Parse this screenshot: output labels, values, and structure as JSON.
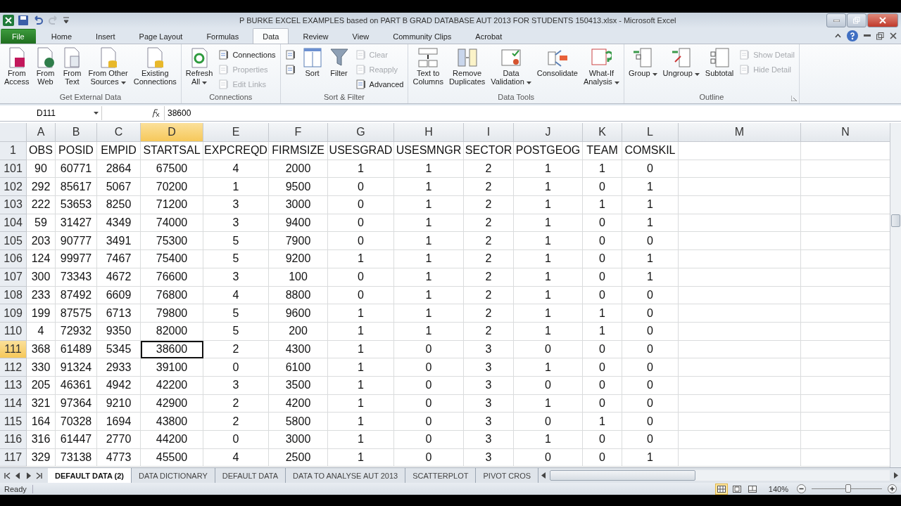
{
  "window": {
    "title": "P BURKE EXCEL EXAMPLES based on PART B GRAD DATABASE AUT 2013 FOR STUDENTS 150413.xlsx  -  Microsoft Excel"
  },
  "tabs": [
    {
      "label": "File",
      "kind": "file",
      "selected": false
    },
    {
      "label": "Home",
      "kind": "tab",
      "selected": false
    },
    {
      "label": "Insert",
      "kind": "tab",
      "selected": false
    },
    {
      "label": "Page Layout",
      "kind": "tab",
      "selected": false
    },
    {
      "label": "Formulas",
      "kind": "tab",
      "selected": false
    },
    {
      "label": "Data",
      "kind": "tab",
      "selected": true
    },
    {
      "label": "Review",
      "kind": "tab",
      "selected": false
    },
    {
      "label": "View",
      "kind": "tab",
      "selected": false
    },
    {
      "label": "Community Clips",
      "kind": "tab",
      "selected": false
    },
    {
      "label": "Acrobat",
      "kind": "tab",
      "selected": false
    }
  ],
  "ribbon": {
    "groups": [
      {
        "label": "Get External Data",
        "items": [
          {
            "kind": "large",
            "lines": [
              "From",
              "Access"
            ]
          },
          {
            "kind": "large",
            "lines": [
              "From",
              "Web"
            ]
          },
          {
            "kind": "large",
            "lines": [
              "From",
              "Text"
            ]
          },
          {
            "kind": "large",
            "lines": [
              "From Other",
              "Sources"
            ],
            "dropdown": true
          },
          {
            "kind": "large",
            "lines": [
              "Existing",
              "Connections"
            ]
          }
        ]
      },
      {
        "label": "Connections",
        "items": [
          {
            "kind": "large",
            "lines": [
              "Refresh",
              "All"
            ],
            "dropdown": true
          },
          {
            "kind": "stack",
            "items": [
              {
                "label": "Connections",
                "disabled": false
              },
              {
                "label": "Properties",
                "disabled": true
              },
              {
                "label": "Edit Links",
                "disabled": true
              }
            ]
          }
        ]
      },
      {
        "label": "Sort & Filter",
        "items": [
          {
            "kind": "stack",
            "items": [
              {
                "disabled": false
              },
              {
                "disabled": false
              }
            ]
          },
          {
            "kind": "large",
            "lines": [
              "Sort"
            ]
          },
          {
            "kind": "large",
            "lines": [
              "Filter"
            ]
          },
          {
            "kind": "stack",
            "items": [
              {
                "label": "Clear",
                "disabled": true
              },
              {
                "label": "Reapply",
                "disabled": true
              },
              {
                "label": "Advanced",
                "disabled": false
              }
            ]
          }
        ]
      },
      {
        "label": "Data Tools",
        "items": [
          {
            "kind": "large",
            "lines": [
              "Text to",
              "Columns"
            ]
          },
          {
            "kind": "large",
            "lines": [
              "Remove",
              "Duplicates"
            ]
          },
          {
            "kind": "large",
            "lines": [
              "Data",
              "Validation"
            ],
            "dropdown": true
          },
          {
            "kind": "large",
            "lines": [
              "Consolidate"
            ]
          },
          {
            "kind": "large",
            "lines": [
              "What-If",
              "Analysis"
            ],
            "dropdown": true
          }
        ]
      },
      {
        "label": "Outline",
        "launcher": true,
        "items": [
          {
            "kind": "large",
            "lines": [
              "Group"
            ],
            "dropdown": true
          },
          {
            "kind": "large",
            "lines": [
              "Ungroup"
            ],
            "dropdown": true
          },
          {
            "kind": "large",
            "lines": [
              "Subtotal"
            ]
          },
          {
            "kind": "stack",
            "items": [
              {
                "label": "Show Detail",
                "disabled": true
              },
              {
                "label": "Hide Detail",
                "disabled": true
              }
            ]
          }
        ]
      }
    ]
  },
  "formula_bar": {
    "name_box": "D111",
    "value": "38600"
  },
  "sheet": {
    "columns": [
      {
        "label": "A",
        "selected": false
      },
      {
        "label": "B",
        "selected": false
      },
      {
        "label": "C",
        "selected": false
      },
      {
        "label": "D",
        "selected": true
      },
      {
        "label": "E",
        "selected": false
      },
      {
        "label": "F",
        "selected": false
      },
      {
        "label": "G",
        "selected": false
      },
      {
        "label": "H",
        "selected": false
      },
      {
        "label": "I",
        "selected": false
      },
      {
        "label": "J",
        "selected": false
      },
      {
        "label": "K",
        "selected": false
      },
      {
        "label": "L",
        "selected": false
      },
      {
        "label": "M",
        "selected": false
      },
      {
        "label": "N",
        "selected": false
      }
    ],
    "rows": [
      {
        "header": "1",
        "selected": false,
        "cells": [
          "OBS",
          "POSID",
          "EMPID",
          "STARTSAL",
          "EXPCREQD",
          "FIRMSIZE",
          "USESGRAD",
          "USESMNGR",
          "SECTOR",
          "POSTGEOG",
          "TEAM",
          "COMSKIL"
        ]
      },
      {
        "header": "101",
        "selected": false,
        "cells": [
          "90",
          "60771",
          "2864",
          "67500",
          "4",
          "2000",
          "1",
          "1",
          "2",
          "1",
          "1",
          "0"
        ]
      },
      {
        "header": "102",
        "selected": false,
        "cells": [
          "292",
          "85617",
          "5067",
          "70200",
          "1",
          "9500",
          "0",
          "1",
          "2",
          "1",
          "0",
          "1"
        ]
      },
      {
        "header": "103",
        "selected": false,
        "cells": [
          "222",
          "53653",
          "8250",
          "71200",
          "3",
          "3000",
          "0",
          "1",
          "2",
          "1",
          "1",
          "1"
        ]
      },
      {
        "header": "104",
        "selected": false,
        "cells": [
          "59",
          "31427",
          "4349",
          "74000",
          "3",
          "9400",
          "0",
          "1",
          "2",
          "1",
          "0",
          "1"
        ]
      },
      {
        "header": "105",
        "selected": false,
        "cells": [
          "203",
          "90777",
          "3491",
          "75300",
          "5",
          "7900",
          "0",
          "1",
          "2",
          "1",
          "0",
          "0"
        ]
      },
      {
        "header": "106",
        "selected": false,
        "cells": [
          "124",
          "99977",
          "7467",
          "75400",
          "5",
          "9200",
          "1",
          "1",
          "2",
          "1",
          "0",
          "1"
        ]
      },
      {
        "header": "107",
        "selected": false,
        "cells": [
          "300",
          "73343",
          "4672",
          "76600",
          "3",
          "100",
          "0",
          "1",
          "2",
          "1",
          "0",
          "1"
        ]
      },
      {
        "header": "108",
        "selected": false,
        "cells": [
          "233",
          "87492",
          "6609",
          "76800",
          "4",
          "8800",
          "0",
          "1",
          "2",
          "1",
          "0",
          "0"
        ]
      },
      {
        "header": "109",
        "selected": false,
        "cells": [
          "199",
          "87575",
          "6713",
          "79800",
          "5",
          "9600",
          "1",
          "1",
          "2",
          "1",
          "1",
          "0"
        ]
      },
      {
        "header": "110",
        "selected": false,
        "cells": [
          "4",
          "72932",
          "9350",
          "82000",
          "5",
          "200",
          "1",
          "1",
          "2",
          "1",
          "1",
          "0"
        ]
      },
      {
        "header": "111",
        "selected": true,
        "cells": [
          "368",
          "61489",
          "5345",
          "38600",
          "2",
          "4300",
          "1",
          "0",
          "3",
          "0",
          "0",
          "0"
        ]
      },
      {
        "header": "112",
        "selected": false,
        "cells": [
          "330",
          "91324",
          "2933",
          "39100",
          "0",
          "6100",
          "1",
          "0",
          "3",
          "1",
          "0",
          "0"
        ]
      },
      {
        "header": "113",
        "selected": false,
        "cells": [
          "205",
          "46361",
          "4942",
          "42200",
          "3",
          "3500",
          "1",
          "0",
          "3",
          "0",
          "0",
          "0"
        ]
      },
      {
        "header": "114",
        "selected": false,
        "cells": [
          "321",
          "97364",
          "9210",
          "42900",
          "2",
          "4200",
          "1",
          "0",
          "3",
          "1",
          "0",
          "0"
        ]
      },
      {
        "header": "115",
        "selected": false,
        "cells": [
          "164",
          "70328",
          "1694",
          "43800",
          "2",
          "5800",
          "1",
          "0",
          "3",
          "0",
          "1",
          "0"
        ]
      },
      {
        "header": "116",
        "selected": false,
        "cells": [
          "316",
          "61447",
          "2770",
          "44200",
          "0",
          "3000",
          "1",
          "0",
          "3",
          "1",
          "0",
          "0"
        ]
      },
      {
        "header": "117",
        "selected": false,
        "cells": [
          "329",
          "73138",
          "4773",
          "45500",
          "4",
          "2500",
          "1",
          "0",
          "3",
          "0",
          "0",
          "1"
        ]
      }
    ]
  },
  "sheet_tabs": [
    {
      "label": "DEFAULT DATA (2)",
      "selected": true
    },
    {
      "label": "DATA DICTIONARY",
      "selected": false
    },
    {
      "label": "DEFAULT DATA",
      "selected": false
    },
    {
      "label": "DATA TO ANALYSE AUT 2013",
      "selected": false
    },
    {
      "label": "SCATTERPLOT",
      "selected": false
    },
    {
      "label": "PIVOT CROS",
      "selected": false
    }
  ],
  "status_bar": {
    "status": "Ready",
    "views": [
      {
        "selected": true
      },
      {
        "selected": false
      },
      {
        "selected": false
      }
    ],
    "zoom": "140%",
    "zoom_slider": {
      "level": 0.52
    }
  }
}
